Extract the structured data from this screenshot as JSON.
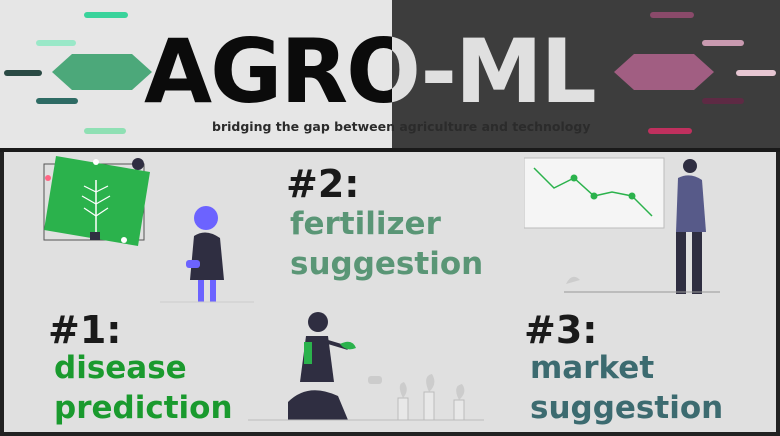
{
  "header": {
    "title_dark_part": "AGRO",
    "title_light_part": "-ML",
    "tagline": "bridging the gap between agriculture and technology"
  },
  "features": [
    {
      "number": "#1:",
      "line1": "disease",
      "line2": "prediction",
      "color": "#1a9a2e"
    },
    {
      "number": "#2:",
      "line1": "fertilizer",
      "line2": "suggestion",
      "color": "#5a9676"
    },
    {
      "number": "#3:",
      "line1": "market",
      "line2": "suggestion",
      "color": "#3c6b70"
    }
  ],
  "colors": {
    "left_bg": "#e6e6e6",
    "right_bg": "#3d3d3d",
    "panel_bg": "#e0e0e0",
    "green_diamond": "#4ca87a",
    "pink_diamond": "#a15e82",
    "accent_purple": "#6c63ff"
  }
}
